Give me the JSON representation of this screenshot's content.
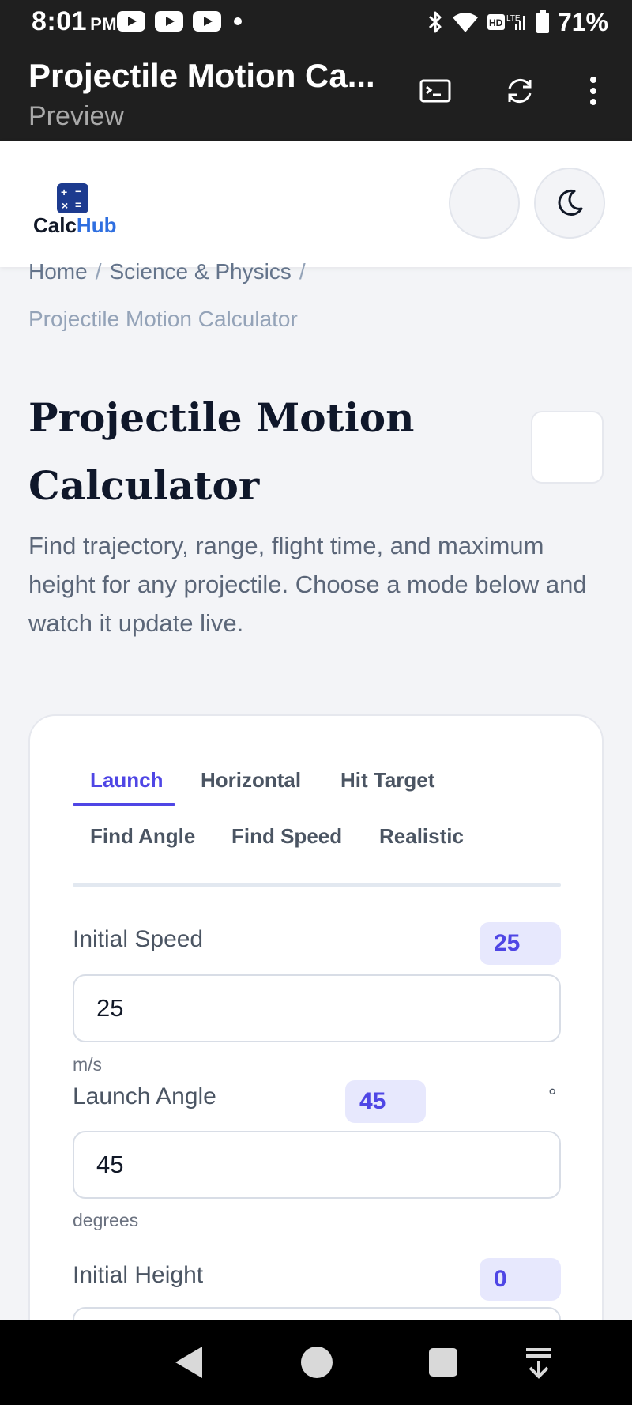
{
  "status_bar": {
    "time": "8:01",
    "ampm": "PM",
    "battery_percent": "71%",
    "icons": [
      "youtube-icon",
      "youtube-icon",
      "youtube-icon",
      "notification-dot",
      "bluetooth-icon",
      "wifi-icon",
      "hd-volte-icon",
      "signal-icon",
      "battery-icon"
    ]
  },
  "app_bar": {
    "title": "Projectile Motion Ca...",
    "subtitle": "Preview",
    "icons": [
      "terminal-icon",
      "refresh-icon",
      "more-vert-icon"
    ]
  },
  "header": {
    "logo_text_a": "Calc",
    "logo_text_b": "Hub",
    "brand_color": "#2f6fe0",
    "buttons": [
      "blank-round-button",
      "moon-icon"
    ]
  },
  "breadcrumb": {
    "home": "Home",
    "separator": "/",
    "category": "Science & Physics",
    "current": "Projectile Motion Calculator"
  },
  "page": {
    "title": "Projectile Motion Calculator",
    "description": "Find trajectory, range, flight time, and maximum height for any projectile. Choose a mode below and watch it update live."
  },
  "tabs": [
    {
      "label": "Launch",
      "active": true
    },
    {
      "label": "Horizontal",
      "active": false
    },
    {
      "label": "Hit Target",
      "active": false
    },
    {
      "label": "Find Angle",
      "active": false
    },
    {
      "label": "Find Speed",
      "active": false
    },
    {
      "label": "Realistic",
      "active": false
    }
  ],
  "fields": [
    {
      "label": "Initial Speed",
      "chip": "25",
      "value": "25",
      "unit": "m/s"
    },
    {
      "label": "Launch Angle",
      "chip": "45",
      "value": "45",
      "unit": "degrees",
      "symbol": "°"
    },
    {
      "label": "Initial Height",
      "chip": "0"
    }
  ],
  "accent_color": "#4f46e5"
}
